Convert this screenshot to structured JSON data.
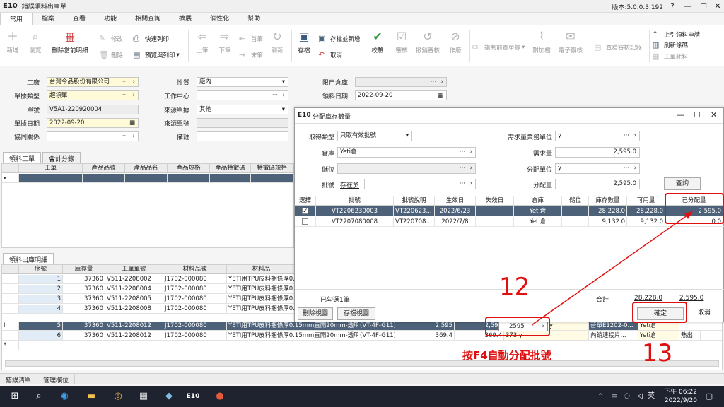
{
  "app": {
    "logo": "E10",
    "title": "錯誤領料出庫單",
    "version": "版本:5.0.0.3.192",
    "win_help": "?",
    "win_min": "—",
    "win_max": "☐",
    "win_close": "✕"
  },
  "menu": [
    "常用",
    "檔案",
    "查看",
    "功能",
    "相關查詢",
    "擴展",
    "個性化",
    "幫助"
  ],
  "ribbon": {
    "new": "新增",
    "browse": "瀏覽",
    "delete_current": "刪除當前明細",
    "edit": "修改",
    "remove": "刪除",
    "quick_print": "快速列印",
    "preview_print": "預覽與列印",
    "prev": "上筆",
    "next": "下筆",
    "first": "首筆",
    "last": "末筆",
    "refresh": "刷新",
    "save": "存檔",
    "save_new": "存檔並新增",
    "cancel": "取消",
    "validate": "校驗",
    "review": "審核",
    "unreview": "撤銷審核",
    "void": "作廢",
    "copy_prev": "複制前置單據",
    "attach": "附加檔",
    "e_sign": "電子簽核",
    "view_review": "查看審核記錄",
    "upper_print": "上引領料申請",
    "refresh_batch": "刷新條碼",
    "work_material": "工單耗料"
  },
  "form": {
    "factory_label": "工廠",
    "factory_value": "台灣今品股份有限公司",
    "doc_type_label": "單據類型",
    "doc_type_value": "超領單",
    "doc_no_label": "單號",
    "doc_no_value": "V5A1-220920004",
    "doc_date_label": "單據日期",
    "doc_date_value": "2022-09-20",
    "co_label": "協同關係",
    "nature_label": "性質",
    "nature_value": "廠內",
    "work_center_label": "工作中心",
    "source_doc_label": "來源單據",
    "source_doc_value": "其他",
    "source_no_label": "來源單號",
    "remark_label": "備註",
    "limit_wh_label": "限用倉庫",
    "pick_date_label": "領料日期",
    "pick_date_value": "2022-09-20",
    "status_label": "",
    "status_value": "簡體碼"
  },
  "top_grid": {
    "tabs": [
      "領料工單",
      "會計分錄"
    ],
    "headers": [
      "工單",
      "產品品號",
      "產品品名",
      "產品規格",
      "產品特徵碼",
      "特徵碼規格"
    ]
  },
  "detail_grid": {
    "tab": "領料出庫明細",
    "headers": [
      "序號",
      "庫存量",
      "工單單號",
      "材料品號",
      "材料品"
    ],
    "rows": [
      {
        "seq": "1",
        "stock": "37360",
        "wo": "V511-2208002",
        "item": "J1702-000080",
        "name": "YETI用TPU皮料捆條厚0.1"
      },
      {
        "seq": "2",
        "stock": "37360",
        "wo": "V511-2208004",
        "item": "J1702-000080",
        "name": "YETI用TPU皮料捆條厚0.1"
      },
      {
        "seq": "3",
        "stock": "37360",
        "wo": "V511-2208005",
        "item": "J1702-000080",
        "name": "YETI用TPU皮料捆條厚0.1"
      },
      {
        "seq": "4",
        "stock": "37360",
        "wo": "V511-2208008",
        "item": "J1702-000080",
        "name": "YETI用TPU皮料捆條厚0.1"
      },
      {
        "seq": "5",
        "stock": "37360",
        "wo": "V511-2208012",
        "item": "J1702-000080",
        "name": "YETI用TPU皮料捆條厚0.15mm直開20mm-透明",
        "spec": "(VT-4F-G11)",
        "qty": "2,595",
        "qty2": "2,595",
        "edit": "2595",
        "unit": "y",
        "cell": "替單E1202-0...",
        "wh": "Yeti倉"
      },
      {
        "seq": "6",
        "stock": "37360",
        "wo": "V511-2208012",
        "item": "J1702-000080",
        "name": "YETI用TPU皮料捆條厚0.15mm直開20mm-透明",
        "spec": "(VT-4F-G11)",
        "qty": "369.4",
        "qty2": "369.4",
        "edit": "",
        "unit": "373 y",
        "cell": "內銷連接片...",
        "wh": "Yeti倉",
        "extra": "熱出"
      }
    ],
    "row_indicator": "I"
  },
  "dialog": {
    "logo": "E10",
    "title": "分配庫存數量",
    "win_min": "—",
    "win_max": "☐",
    "win_close": "✕",
    "fetch_type_label": "取得類型",
    "fetch_type_value": "只取有效批號",
    "warehouse_label": "倉庫",
    "warehouse_value": "Yeti倉",
    "location_label": "儲位",
    "batch_label": "批號",
    "batch_value": "存在於",
    "demand_unit_label": "需求量業務單位",
    "demand_unit_value": "y",
    "demand_qty_label": "需求量",
    "demand_qty_value": "2,595.0",
    "alloc_unit_label": "分配單位",
    "alloc_unit_value": "y",
    "alloc_qty_label": "分配量",
    "alloc_qty_value": "2,595.0",
    "query_btn": "查詢",
    "headers": [
      "選擇",
      "批號",
      "批號說明",
      "生效日",
      "失效日",
      "倉庫",
      "儲位",
      "庫存數量",
      "可用量",
      "已分配量"
    ],
    "rows": [
      {
        "selected": true,
        "batch": "VT2206230003",
        "desc": "VT220623...",
        "eff": "2022/6/23",
        "exp": "",
        "wh": "Yeti倉",
        "loc": "",
        "stock": "28,228.0",
        "avail": "28,228.0",
        "alloc": "2,595.0"
      },
      {
        "selected": false,
        "batch": "VT2207080008",
        "desc": "VT220708...",
        "eff": "2022/7/8",
        "exp": "",
        "wh": "Yeti倉",
        "loc": "",
        "stock": "9,132.0",
        "avail": "9,132.0",
        "alloc": "0.0"
      }
    ],
    "selected_count": "已勾選1筆",
    "total_label": "合計",
    "total_stock": "28,228.0",
    "total_alloc": "2,595.0",
    "delete_view_btn": "刪除視圖",
    "save_view_btn": "存檔視圖",
    "ok_btn": "確定",
    "cancel_btn": "取消"
  },
  "annotations": {
    "step12": "12",
    "step13": "13",
    "hint": "按F4自動分配批號",
    "color": "#e01010"
  },
  "bottom_tabs": [
    "錯誤清單",
    "管理欄位"
  ],
  "taskbar": {
    "ime": "英",
    "time": "下午 06:22",
    "date": "2022/9/20",
    "app_label": "E10"
  }
}
